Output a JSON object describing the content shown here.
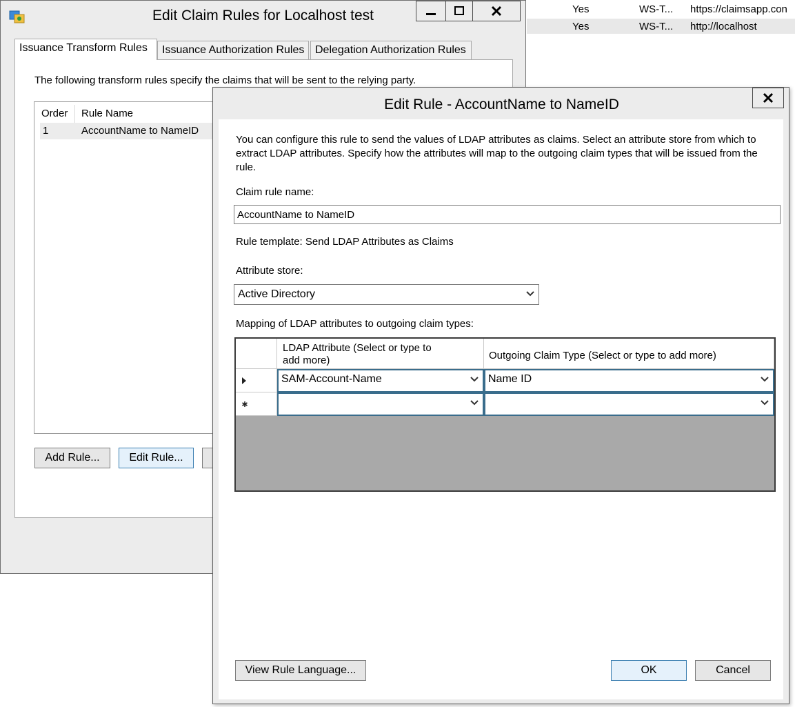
{
  "background_list": {
    "rows": [
      {
        "enabled": "Yes",
        "type": "WS-T...",
        "identifier": "https://claimsapp.con"
      },
      {
        "enabled": "Yes",
        "type": "WS-T...",
        "identifier": "http://localhost"
      }
    ]
  },
  "parent_dialog": {
    "title": "Edit Claim Rules for Localhost test",
    "tabs": [
      {
        "label": "Issuance Transform Rules",
        "active": true
      },
      {
        "label": "Issuance Authorization Rules",
        "active": false
      },
      {
        "label": "Delegation Authorization Rules",
        "active": false
      }
    ],
    "intro": "The following transform rules specify the claims that will be sent to the relying party.",
    "list_headers": {
      "order": "Order",
      "rule_name": "Rule Name"
    },
    "rules": [
      {
        "order": "1",
        "name": "AccountName to NameID"
      }
    ],
    "add_rule_label": "Add Rule...",
    "edit_rule_label": "Edit Rule..."
  },
  "edit_rule_dialog": {
    "title": "Edit Rule - AccountName to NameID",
    "description": "You can configure this rule to send the values of LDAP attributes as claims. Select an attribute store from which to extract LDAP attributes. Specify how the attributes will map to the outgoing claim types that will be issued from the rule.",
    "claim_rule_name_label": "Claim rule name:",
    "claim_rule_name_value": "AccountName to NameID",
    "rule_template": "Rule template: Send LDAP Attributes as Claims",
    "attribute_store_label": "Attribute store:",
    "attribute_store_value": "Active Directory",
    "mapping_label": "Mapping of LDAP attributes to outgoing claim types:",
    "grid": {
      "headers": {
        "ldap_attribute_line1": "LDAP Attribute (Select or type to",
        "ldap_attribute_line2": "add more)",
        "outgoing_claim_type": "Outgoing Claim Type (Select or type to add more)"
      },
      "rows": [
        {
          "marker": "current-row",
          "ldap_attribute": "SAM-Account-Name",
          "claim_type": "Name ID"
        },
        {
          "marker": "new-row",
          "ldap_attribute": "",
          "claim_type": ""
        }
      ]
    },
    "view_rule_language_label": "View Rule Language...",
    "ok_label": "OK",
    "cancel_label": "Cancel"
  },
  "colors": {
    "dialog_bg": "#ececec",
    "grid_empty_area": "#a9a9a9",
    "default_button_border": "#3c7fb1"
  }
}
